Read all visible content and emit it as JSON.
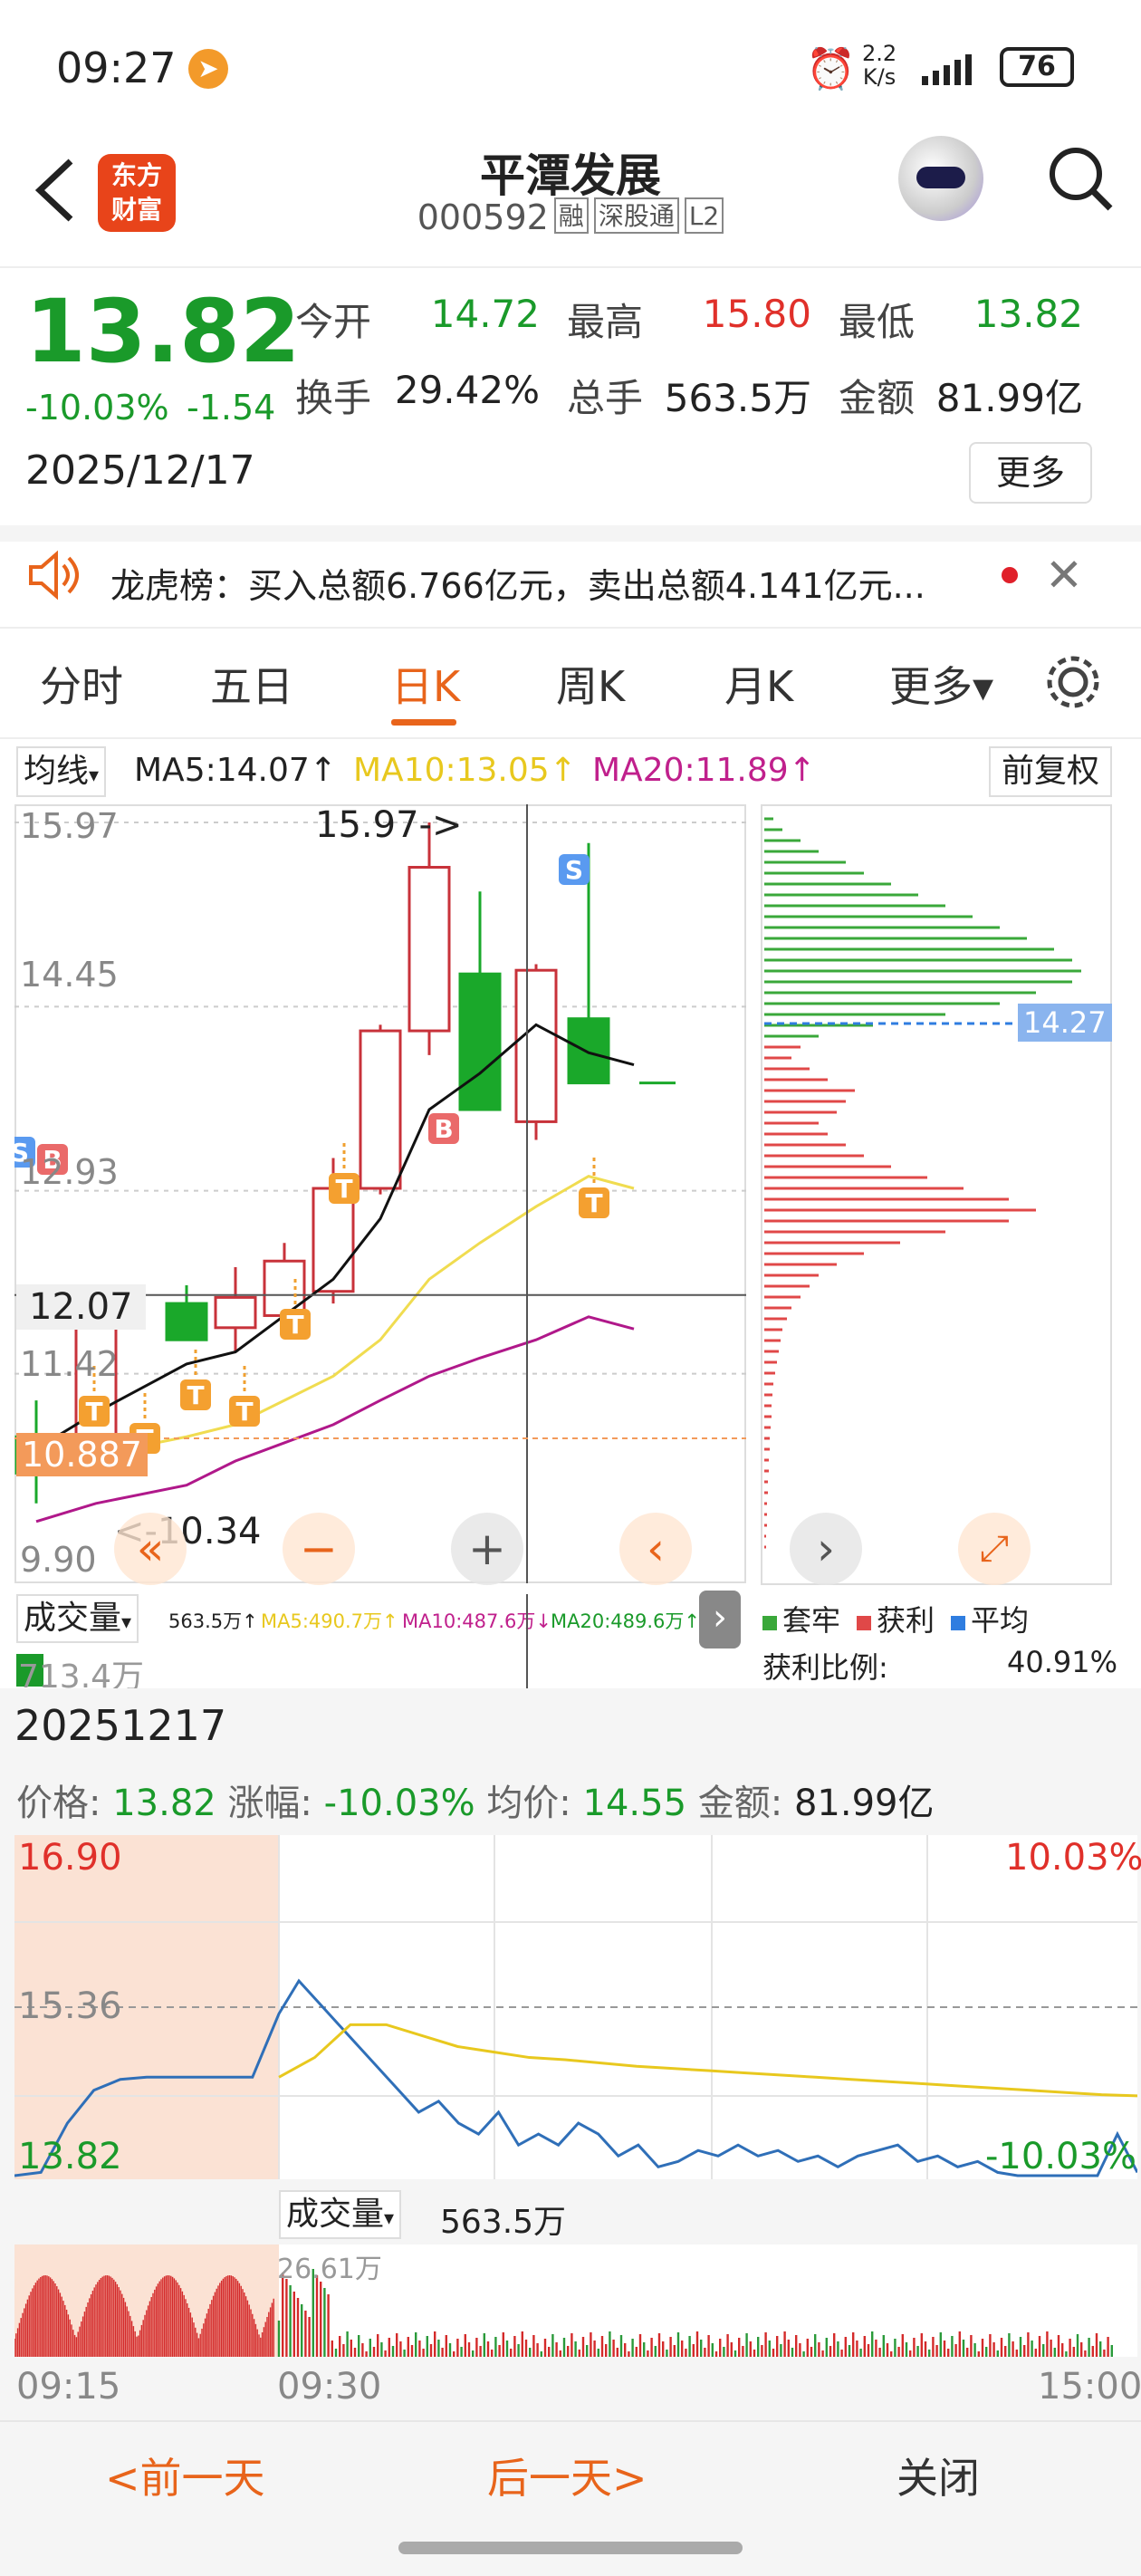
{
  "status": {
    "time": "09:27",
    "net_top": "2.2",
    "net_unit": "K/s",
    "battery": "76"
  },
  "header": {
    "logo_line1": "东方",
    "logo_line2": "财富",
    "stock_name": "平潭发展",
    "code": "000592",
    "tag1": "融",
    "tag2": "深股通",
    "tag3": "L2"
  },
  "quote": {
    "price": "13.82",
    "pct": "-10.03%",
    "chg": "-1.54",
    "date": "2025/12/17",
    "stats": [
      {
        "label": "今开",
        "value": "14.72",
        "color": "green"
      },
      {
        "label": "最高",
        "value": "15.80",
        "color": "red"
      },
      {
        "label": "最低",
        "value": "13.82",
        "color": "green"
      },
      {
        "label": "换手",
        "value": "29.42%",
        "color": "dark"
      },
      {
        "label": "总手",
        "value": "563.5万",
        "color": "dark"
      },
      {
        "label": "金额",
        "value": "81.99亿",
        "color": "dark"
      }
    ],
    "more": "更多"
  },
  "notice": {
    "text": "龙虎榜：买入总额6.766亿元，卖出总额4.141亿元..."
  },
  "tabs": [
    {
      "label": "分时"
    },
    {
      "label": "五日"
    },
    {
      "label": "日K",
      "active": true
    },
    {
      "label": "周K"
    },
    {
      "label": "月K"
    },
    {
      "label": "更多▾"
    }
  ],
  "ma": {
    "type": "均线",
    "ma5": "MA5:14.07↑",
    "ma10": "MA10:13.05↑",
    "ma20": "MA20:11.89↑",
    "adjust": "前复权"
  },
  "kline": {
    "y_labels": [
      "15.97",
      "14.45",
      "12.93",
      "11.42",
      "9.90"
    ],
    "high_annot": "15.97->",
    "low_annot": "<-10.34",
    "cross_price": "12.07",
    "last_close_tag": "10.887",
    "cost_tag": "14.27",
    "chart_data": {
      "type": "candlestick",
      "ylim": [
        9.9,
        15.97
      ],
      "candles": [
        {
          "o": 10.9,
          "h": 11.2,
          "l": 10.35,
          "c": 10.6
        },
        {
          "o": 10.9,
          "h": 11.9,
          "l": 10.75,
          "c": 11.85
        },
        {
          "o": 12.0,
          "h": 12.15,
          "l": 11.7,
          "c": 11.7
        },
        {
          "o": 11.8,
          "h": 12.3,
          "l": 11.6,
          "c": 12.05
        },
        {
          "o": 11.9,
          "h": 12.5,
          "l": 11.75,
          "c": 12.35
        },
        {
          "o": 12.1,
          "h": 13.2,
          "l": 12.0,
          "c": 12.95
        },
        {
          "o": 12.95,
          "h": 14.3,
          "l": 12.9,
          "c": 14.25
        },
        {
          "o": 14.25,
          "h": 15.97,
          "l": 14.05,
          "c": 15.6
        },
        {
          "o": 14.72,
          "h": 15.4,
          "l": 13.6,
          "c": 13.6
        },
        {
          "o": 13.5,
          "h": 14.8,
          "l": 13.35,
          "c": 14.75
        },
        {
          "o": 14.35,
          "h": 15.8,
          "l": 13.82,
          "c": 13.82
        }
      ],
      "ma5": [
        10.8,
        11.1,
        11.5,
        11.6,
        11.9,
        12.2,
        12.7,
        13.6,
        13.9,
        14.3,
        14.07
      ],
      "ma10": [
        10.6,
        10.75,
        10.9,
        11.0,
        11.2,
        11.4,
        11.7,
        12.2,
        12.5,
        12.8,
        13.05
      ],
      "ma20": [
        10.2,
        10.35,
        10.5,
        10.7,
        10.85,
        11.0,
        11.2,
        11.4,
        11.55,
        11.7,
        11.89
      ]
    }
  },
  "chips": {
    "legend": [
      {
        "label": "套牢",
        "color": "#3aa83a"
      },
      {
        "label": "获利",
        "color": "#e04848"
      },
      {
        "label": "平均",
        "color": "#2f7de0"
      }
    ],
    "ratio_label": "获利比例:",
    "ratio": "40.91%"
  },
  "volume": {
    "label": "成交量",
    "total": "563.5万↑",
    "ma5": "MA5:490.7万↑",
    "ma10": "MA10:487.6万↓",
    "ma20": "MA20:489.6万↑",
    "yval": "713.4万"
  },
  "detail": {
    "date": "20251217",
    "price_label": "价格:",
    "price": "13.82",
    "chg_label": "涨幅:",
    "chg": "-10.03%",
    "avg_label": "均价:",
    "avg": "14.55",
    "amt_label": "金额:",
    "amt": "81.99亿"
  },
  "intraday": {
    "top": "16.90",
    "mid": "15.36",
    "bottom": "13.82",
    "top_pct": "10.03%",
    "bottom_pct": "-10.03%",
    "vol_label": "成交量",
    "vol_total": "563.5万",
    "vol_max": "26.61万",
    "t_start": "09:15",
    "t_open": "09:30",
    "t_end": "15:00",
    "chart_data": {
      "type": "line",
      "ylim": [
        13.82,
        16.9
      ],
      "price": [
        13.82,
        13.85,
        14.3,
        14.6,
        14.7,
        14.72,
        14.72,
        14.72,
        14.72,
        14.72,
        15.3,
        15.6,
        15.4,
        15.2,
        15.0,
        14.8,
        14.6,
        14.4,
        14.5,
        14.3,
        14.2,
        14.4,
        14.1,
        14.2,
        14.1,
        14.3,
        14.2,
        14.0,
        14.1,
        13.9,
        13.95,
        14.05,
        14.0,
        14.1,
        14.0,
        14.05,
        13.95,
        14.0,
        13.9,
        14.0,
        14.05,
        14.1,
        13.95,
        14.0,
        13.9,
        13.95,
        13.85,
        13.82,
        13.82,
        13.82,
        13.82,
        13.82,
        14.2,
        13.85
      ],
      "avg": [
        14.72,
        14.9,
        15.2,
        15.2,
        15.1,
        15.0,
        14.95,
        14.9,
        14.88,
        14.85,
        14.82,
        14.8,
        14.78,
        14.76,
        14.74,
        14.72,
        14.7,
        14.68,
        14.66,
        14.64,
        14.62,
        14.6,
        14.58,
        14.56,
        14.55
      ]
    }
  },
  "footer": {
    "prev": "<前一天",
    "next": "后一天>",
    "close": "关闭"
  }
}
